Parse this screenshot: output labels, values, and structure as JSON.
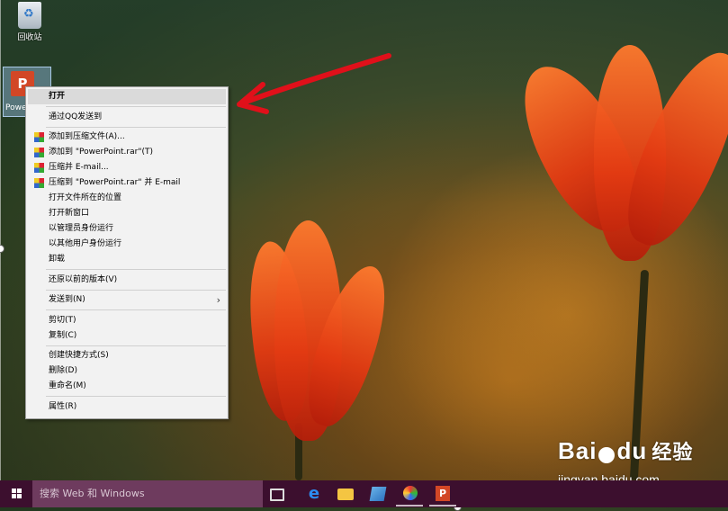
{
  "desktop": {
    "recycle_bin_label": "回收站",
    "ppt_label": "Powe"
  },
  "context_menu": {
    "items": [
      {
        "label": "打开"
      },
      {
        "label": "通过QQ发送到"
      },
      {
        "label": "添加到压缩文件(A)...",
        "icon": "winrar-icon"
      },
      {
        "label": "添加到 \"PowerPoint.rar\"(T)",
        "icon": "winrar-icon"
      },
      {
        "label": "压缩并 E-mail...",
        "icon": "winrar-icon"
      },
      {
        "label": "压缩到 \"PowerPoint.rar\" 并 E-mail",
        "icon": "winrar-icon"
      },
      {
        "label": "打开文件所在的位置"
      },
      {
        "label": "打开新窗口"
      },
      {
        "label": "以管理员身份运行"
      },
      {
        "label": "以其他用户身份运行"
      },
      {
        "label": "卸载"
      },
      {
        "label": "还原以前的版本(V)"
      },
      {
        "label": "发送到(N)"
      },
      {
        "label": "剪切(T)"
      },
      {
        "label": "复制(C)"
      },
      {
        "label": "创建快捷方式(S)"
      },
      {
        "label": "删除(D)"
      },
      {
        "label": "重命名(M)"
      },
      {
        "label": "属性(R)"
      }
    ],
    "submenu_chevron": "›"
  },
  "taskbar": {
    "search_placeholder": "搜索 Web 和 Windows",
    "ppt_letter": "P",
    "edge_letter": "e"
  },
  "watermark": {
    "brand_left": "Bai",
    "brand_right": "du",
    "brand_cn": "经验",
    "url": "jingyan.baidu.com"
  },
  "colors": {
    "taskbar": "#3c0f2e",
    "search_box": "#6e3b5e",
    "annotation_arrow": "#e0101a",
    "ppt_brand": "#d24726"
  }
}
